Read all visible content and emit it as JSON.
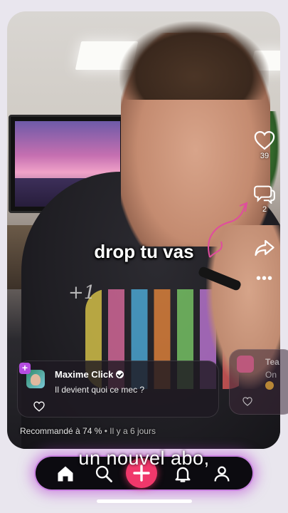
{
  "video": {
    "overlay_caption": "drop tu vas",
    "subtitle": "un nouvel abo,"
  },
  "actions": {
    "like_count": "39",
    "comment_count": "2",
    "icons": [
      "heart-icon",
      "comment-icon",
      "share-icon",
      "more-icon"
    ]
  },
  "comment": {
    "username": "Maxime Click",
    "text": "Il devient quoi ce mec ?",
    "badge": "+"
  },
  "next_comment": {
    "username": "Tea",
    "text": "On"
  },
  "recommendation": {
    "score": "Recommandé à 74 %",
    "time": "• Il y a 6 jours"
  },
  "tabbar": {
    "items": [
      "home-icon",
      "search-icon",
      "create-plus-icon",
      "bell-icon",
      "profile-icon"
    ]
  },
  "colors": {
    "accent": "#f0386b",
    "glow": "#b54de0",
    "badge": "#b54de0"
  }
}
